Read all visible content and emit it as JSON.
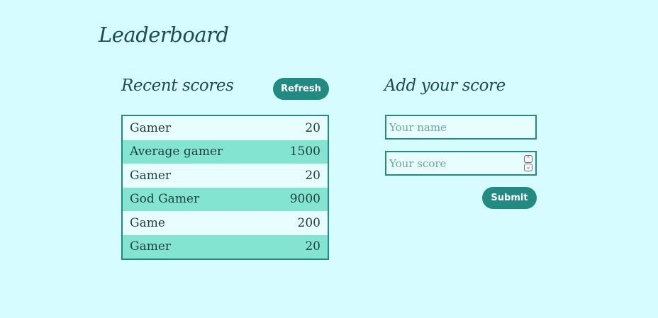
{
  "app": {
    "title": "Leaderboard"
  },
  "recent": {
    "title": "Recent scores",
    "refresh_label": "Refresh",
    "rows": [
      {
        "name": "Gamer",
        "score": "20"
      },
      {
        "name": "Average gamer",
        "score": "1500"
      },
      {
        "name": "Gamer",
        "score": "20"
      },
      {
        "name": "God Gamer",
        "score": "9000"
      },
      {
        "name": "Game",
        "score": "200"
      },
      {
        "name": "Gamer",
        "score": "20"
      }
    ]
  },
  "add": {
    "title": "Add your score",
    "name_placeholder": "Your name",
    "name_value": "",
    "score_placeholder": "Your score",
    "score_value": "",
    "submit_label": "Submit"
  },
  "colors": {
    "background": "#d6fcff",
    "accent": "#218a81",
    "row_alt": "#83e5d1",
    "row_base": "#e8fdfd"
  },
  "icons": {
    "spinner_up": "chevron-up-icon",
    "spinner_down": "chevron-down-icon"
  }
}
